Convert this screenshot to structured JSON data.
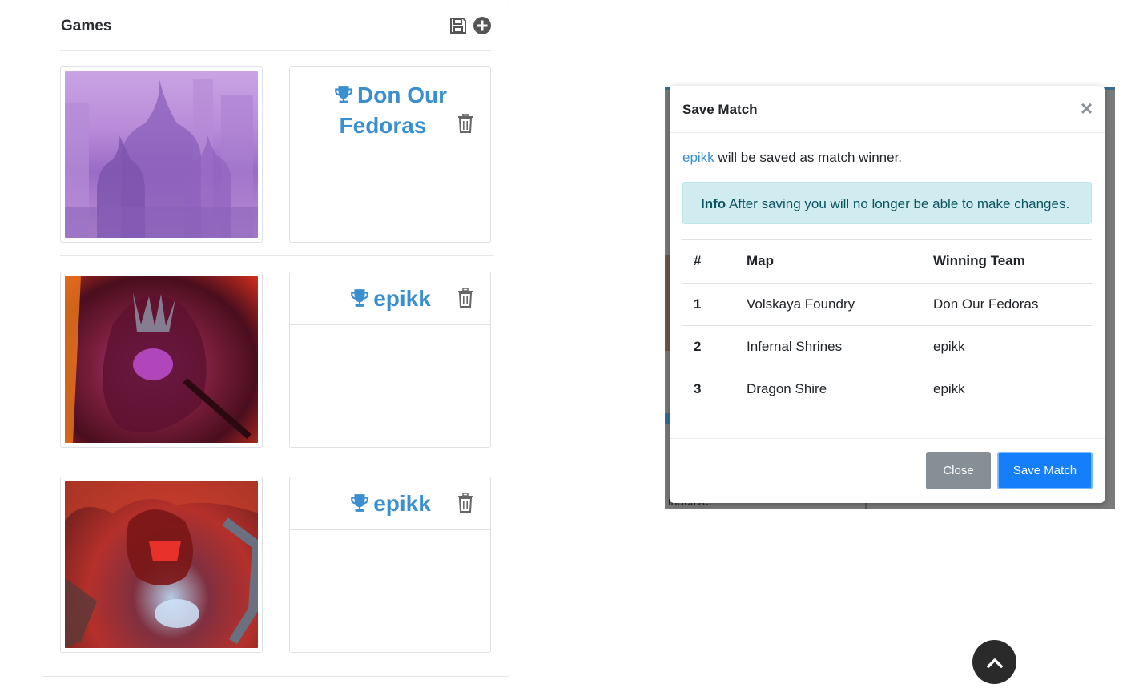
{
  "games": {
    "title": "Games",
    "items": [
      {
        "map": "Volskaya Foundry",
        "winner": "Don Our Fedoras",
        "winner_line1": "Don Our",
        "winner_line2": "Fedoras"
      },
      {
        "map": "Infernal Shrines",
        "winner": "epikk"
      },
      {
        "map": "Dragon Shire",
        "winner": "epikk"
      }
    ]
  },
  "background": {
    "partial_text": "inactive."
  },
  "modal": {
    "title": "Save Match",
    "close_glyph": "×",
    "message_winner": "epikk",
    "message_rest": " will be saved as match winner.",
    "alert_label": "Info",
    "alert_text": " After saving you will no longer be able to make changes.",
    "table": {
      "headers": [
        "#",
        "Map",
        "Winning Team"
      ],
      "rows": [
        [
          "1",
          "Volskaya Foundry",
          "Don Our Fedoras"
        ],
        [
          "2",
          "Infernal Shrines",
          "epikk"
        ],
        [
          "3",
          "Dragon Shire",
          "epikk"
        ]
      ]
    },
    "close_button": "Close",
    "save_button": "Save Match"
  },
  "icons": {
    "save": "floppy-disk-icon",
    "add": "plus-circle-icon",
    "trophy": "trophy-icon",
    "trash": "trash-icon",
    "scroll_top": "chevron-up-icon"
  },
  "colors": {
    "link": "#3a8fd0",
    "primary": "#157efb",
    "secondary": "#868e96",
    "alert_bg": "#d1ecf1",
    "alert_text": "#0c5460"
  }
}
